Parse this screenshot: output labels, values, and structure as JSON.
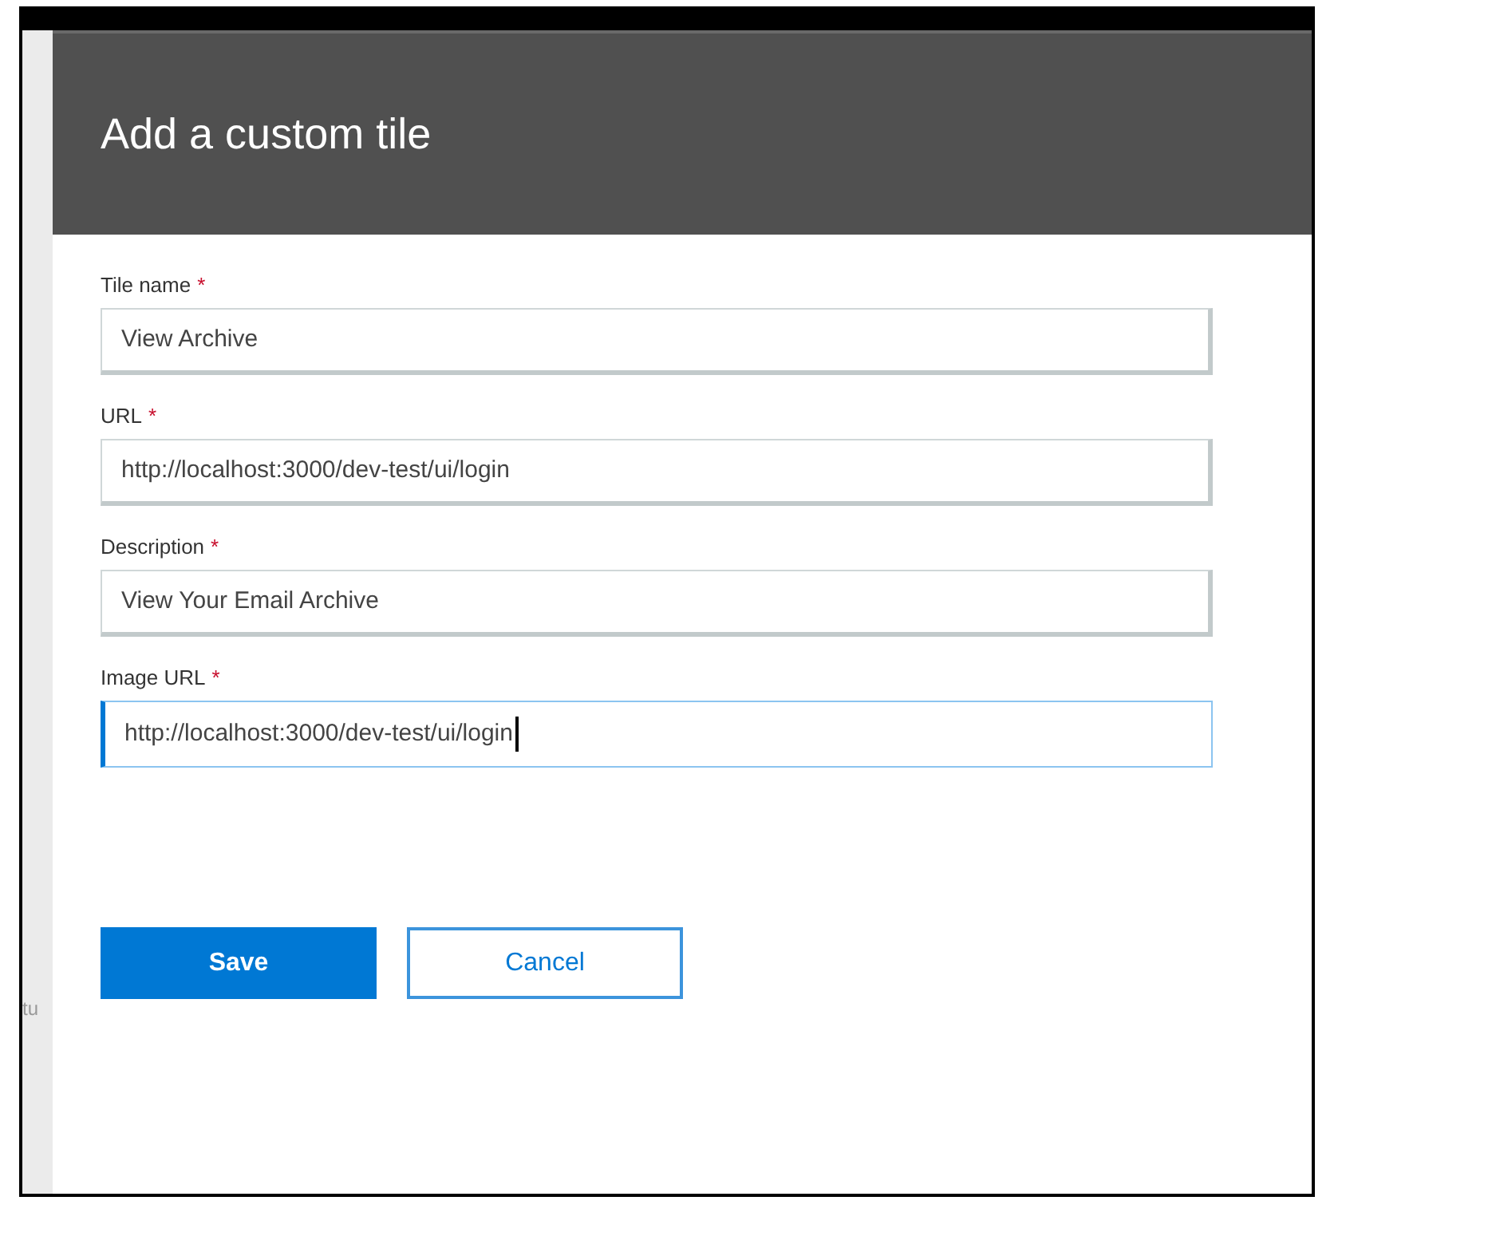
{
  "background": {
    "partial_text": "tu"
  },
  "dialog": {
    "title": "Add a custom tile",
    "fields": [
      {
        "label": "Tile name",
        "required_mark": "*",
        "value": "View Archive",
        "focused": false
      },
      {
        "label": "URL",
        "required_mark": "*",
        "value": "http://localhost:3000/dev-test/ui/login",
        "focused": false
      },
      {
        "label": "Description",
        "required_mark": "*",
        "value": "View Your Email Archive",
        "focused": false
      },
      {
        "label": "Image URL",
        "required_mark": "*",
        "value": "http://localhost:3000/dev-test/ui/login",
        "focused": true
      }
    ],
    "buttons": [
      {
        "label": "Save",
        "kind": "primary"
      },
      {
        "label": "Cancel",
        "kind": "secondary"
      }
    ]
  }
}
